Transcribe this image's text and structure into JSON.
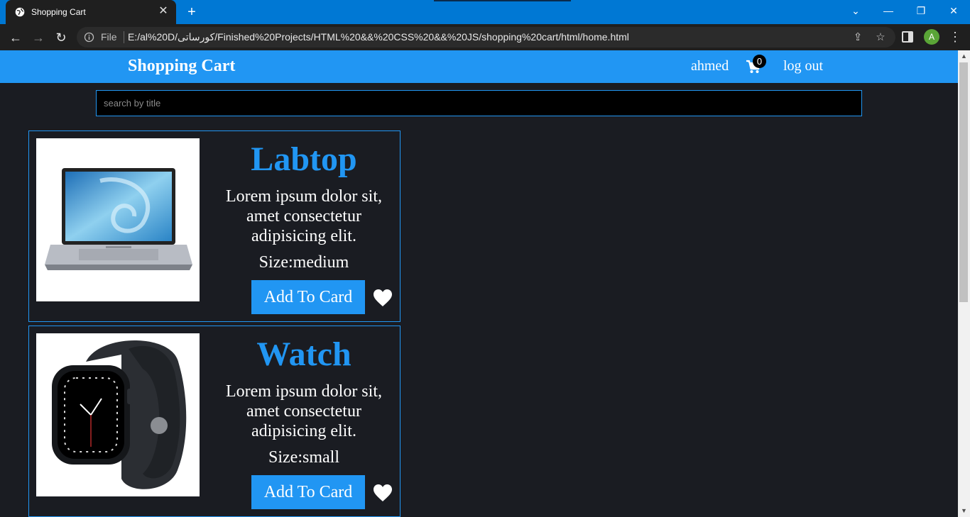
{
  "browser": {
    "tab_title": "Shopping Cart",
    "tab_close": "✕",
    "new_tab": "+",
    "file_label": "File",
    "url": "E:/al%20D/كورساتى/Finished%20Projects/HTML%20&&%20CSS%20&&%20JS/shopping%20cart/html/home.html",
    "profile_initial": "A"
  },
  "header": {
    "brand": "Shopping Cart",
    "username": "ahmed",
    "cart_count": "0",
    "logout_label": "log out"
  },
  "search": {
    "placeholder": "search by title"
  },
  "products": [
    {
      "title": "Labtop",
      "description": "Lorem ipsum dolor sit, amet consectetur adipisicing elit.",
      "size": "Size:medium",
      "button": "Add To Card",
      "image_icon": "laptop-image"
    },
    {
      "title": "Watch",
      "description": "Lorem ipsum dolor sit, amet consectetur adipisicing elit.",
      "size": "Size:small",
      "button": "Add To Card",
      "image_icon": "smartwatch-image"
    }
  ],
  "colors": {
    "accent": "#2196f3",
    "page_bg": "#1a1c22",
    "browser_tabbar": "#0078d4"
  }
}
